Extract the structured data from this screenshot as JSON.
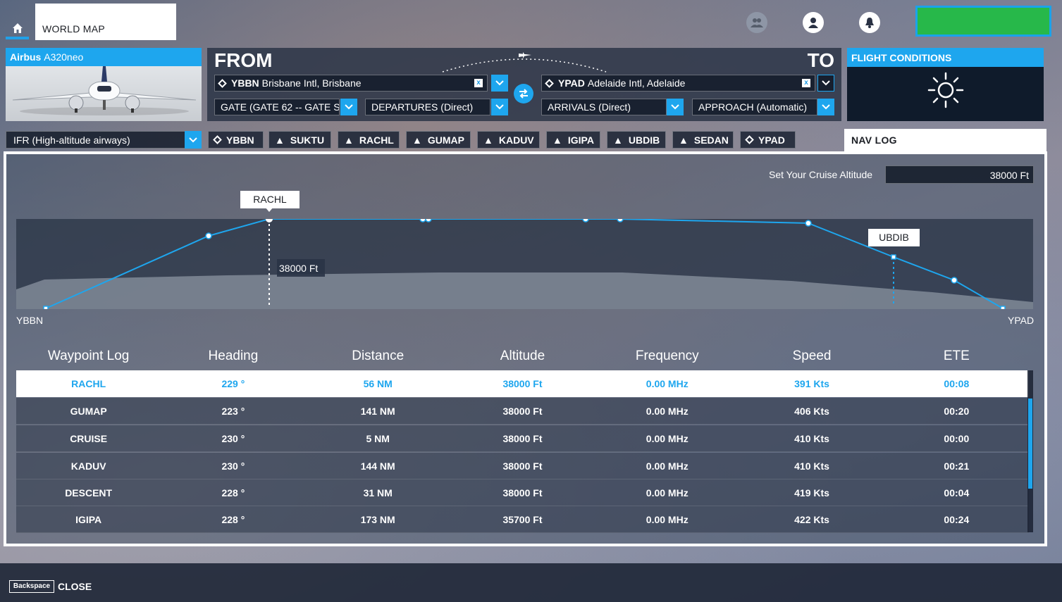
{
  "topbar": {
    "world_map": "WORLD MAP"
  },
  "aircraft": {
    "maker": "Airbus",
    "model": "A320neo"
  },
  "from": {
    "title": "FROM",
    "code": "YBBN",
    "name": "Brisbane Intl, Brisbane",
    "gate": "GATE (GATE 62 -- GATE S",
    "departure": "DEPARTURES (Direct)"
  },
  "to": {
    "title": "TO",
    "code": "YPAD",
    "name": "Adelaide Intl, Adelaide",
    "arrival": "ARRIVALS (Direct)",
    "approach": "APPROACH (Automatic)"
  },
  "conditions": {
    "title": "FLIGHT CONDITIONS",
    "icon": "sun-icon"
  },
  "route": {
    "type": "IFR (High-altitude airways)",
    "waypoints": [
      "YBBN",
      "SUKTU",
      "RACHL",
      "GUMAP",
      "KADUV",
      "IGIPA",
      "UBDIB",
      "SEDAN",
      "YPAD"
    ]
  },
  "navlog": {
    "tab": "NAV LOG",
    "cruise_label": "Set Your Cruise Altitude",
    "cruise_value": "38000 Ft",
    "profile": {
      "start": "YBBN",
      "end": "YPAD",
      "tag_top": "RACHL",
      "tag_alt": "38000 Ft",
      "tag_desc": "UBDIB"
    },
    "columns": [
      "Waypoint Log",
      "Heading",
      "Distance",
      "Altitude",
      "Frequency",
      "Speed",
      "ETE"
    ],
    "rows": [
      [
        "RACHL",
        "229 °",
        "56 NM",
        "38000 Ft",
        "0.00 MHz",
        "391 Kts",
        "00:08"
      ],
      [
        "GUMAP",
        "223 °",
        "141 NM",
        "38000 Ft",
        "0.00 MHz",
        "406 Kts",
        "00:20"
      ],
      [
        "CRUISE",
        "230 °",
        "5 NM",
        "38000 Ft",
        "0.00 MHz",
        "410 Kts",
        "00:00"
      ],
      [
        "KADUV",
        "230 °",
        "144 NM",
        "38000 Ft",
        "0.00 MHz",
        "410 Kts",
        "00:21"
      ],
      [
        "DESCENT",
        "228 °",
        "31 NM",
        "38000 Ft",
        "0.00 MHz",
        "419 Kts",
        "00:04"
      ],
      [
        "IGIPA",
        "228 °",
        "173 NM",
        "35700 Ft",
        "0.00 MHz",
        "422 Kts",
        "00:24"
      ]
    ]
  },
  "footer": {
    "key": "Backspace",
    "close": "CLOSE"
  },
  "colors": {
    "accent": "#1ea6ee",
    "green": "#27b84a"
  }
}
